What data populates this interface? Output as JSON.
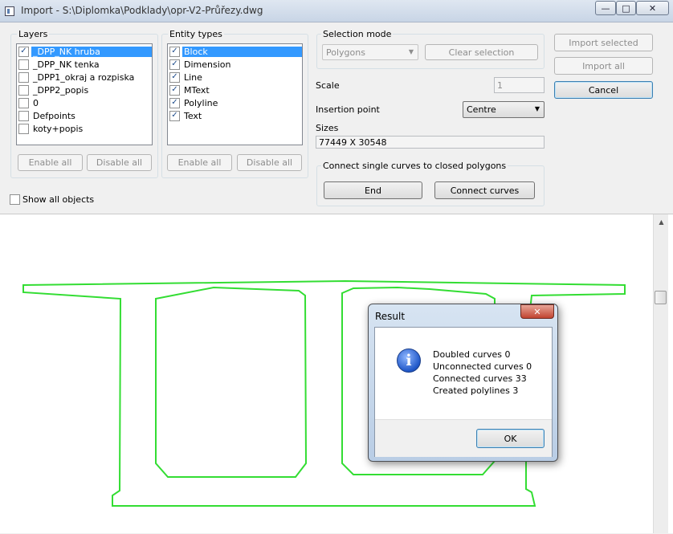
{
  "window": {
    "title": "Import - S:\\Diplomka\\Podklady\\opr-V2-Průřezy.dwg",
    "controls": {
      "minimize": "—",
      "maximize": "□",
      "close": "✕"
    }
  },
  "layers": {
    "label": "Layers",
    "items": [
      {
        "label": "_DPP_NK hruba",
        "checked": true,
        "selected": true
      },
      {
        "label": "_DPP_NK tenka",
        "checked": false
      },
      {
        "label": "_DPP1_okraj a rozpiska",
        "checked": false
      },
      {
        "label": "_DPP2_popis",
        "checked": false
      },
      {
        "label": "0",
        "checked": false
      },
      {
        "label": "Defpoints",
        "checked": false
      },
      {
        "label": "koty+popis",
        "checked": false
      }
    ],
    "enable_all": "Enable all",
    "disable_all": "Disable all"
  },
  "entity_types": {
    "label": "Entity types",
    "items": [
      {
        "label": "Block",
        "checked": true,
        "selected": true
      },
      {
        "label": "Dimension",
        "checked": true
      },
      {
        "label": "Line",
        "checked": true
      },
      {
        "label": "MText",
        "checked": true
      },
      {
        "label": "Polyline",
        "checked": true
      },
      {
        "label": "Text",
        "checked": true
      }
    ],
    "enable_all": "Enable all",
    "disable_all": "Disable all"
  },
  "selection_mode": {
    "label": "Selection mode",
    "value": "Polygons",
    "clear_selection": "Clear selection"
  },
  "scale": {
    "label": "Scale",
    "value": "1"
  },
  "insertion_point": {
    "label": "Insertion point",
    "value": "Centre"
  },
  "sizes": {
    "label": "Sizes",
    "value": "77449 X 30548"
  },
  "connect": {
    "label": "Connect single curves to closed polygons",
    "end": "End",
    "connect_curves": "Connect curves"
  },
  "buttons": {
    "import_selected": "Import selected",
    "import_all": "Import all",
    "cancel": "Cancel"
  },
  "show_all_objects": {
    "label": "Show all objects",
    "checked": false
  },
  "scroll_up_glyph": "▲",
  "checkmark_glyph": "✓",
  "result_dialog": {
    "title": "Result",
    "close": "✕",
    "info_glyph": "i",
    "lines": [
      "Doubled curves 0",
      "Unconnected curves 0",
      "Connected curves 33",
      "Created polylines 3"
    ],
    "ok": "OK"
  },
  "colors": {
    "drawing_stroke": "#33dd33",
    "selection": "#3399ff",
    "window_bg": "#f0f0f0"
  }
}
